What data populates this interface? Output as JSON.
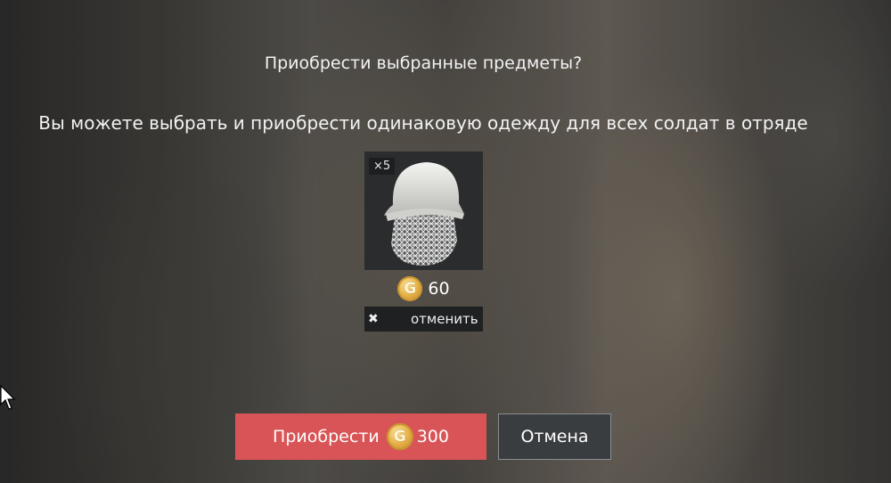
{
  "dialog": {
    "title": "Приобрести выбранные предметы?",
    "subtitle": "Вы можете выбрать и приобрести одинаковую одежду для всех солдат в отряде"
  },
  "item": {
    "icon": "balaclava-helmet-icon",
    "count": "×5",
    "price": "60",
    "currency_icon": "gold-coin-icon",
    "cancel_label": "отменить"
  },
  "actions": {
    "buy_label": "Приобрести",
    "buy_price": "300",
    "cancel_label": "Отмена"
  },
  "colors": {
    "buy_button": "#d95456",
    "cancel_button": "#3a3d40",
    "coin": "#e8b34a"
  }
}
